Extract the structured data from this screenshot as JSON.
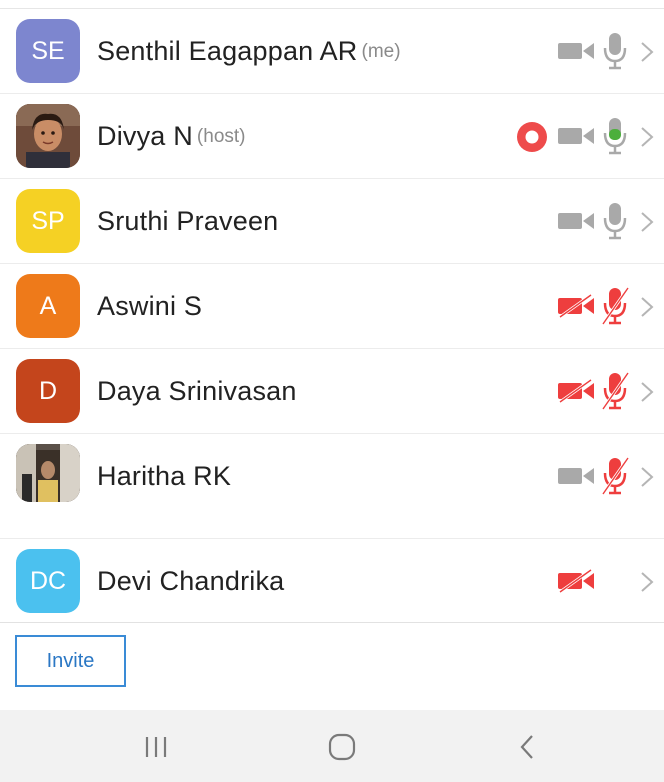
{
  "participants": [
    {
      "initials": "SE",
      "name": "Senthil Eagappan AR",
      "tag": "(me)",
      "avatar_color": "#7d86cf",
      "video": "off",
      "audio": "muted",
      "recording": false
    },
    {
      "initials": "",
      "name": "Divya N",
      "tag": "(host)",
      "avatar_color": "#6b4a3a",
      "video": "off",
      "audio": "speaking",
      "recording": true
    },
    {
      "initials": "SP",
      "name": "Sruthi Praveen",
      "tag": "",
      "avatar_color": "#f5d124",
      "video": "off",
      "audio": "muted",
      "recording": false
    },
    {
      "initials": "A",
      "name": "Aswini S",
      "tag": "",
      "avatar_color": "#ee7a1a",
      "video": "disabled",
      "audio": "disabled",
      "recording": false
    },
    {
      "initials": "D",
      "name": "Daya Srinivasan",
      "tag": "",
      "avatar_color": "#c4451c",
      "video": "disabled",
      "audio": "disabled",
      "recording": false
    },
    {
      "initials": "",
      "name": "Haritha RK",
      "tag": "",
      "avatar_color": "#4a4038",
      "video": "off",
      "audio": "disabled",
      "recording": false
    },
    {
      "initials": "DC",
      "name": "Devi Chandrika",
      "tag": "",
      "avatar_color": "#4bc1ef",
      "video": "disabled",
      "audio": "none",
      "recording": false
    }
  ],
  "footer": {
    "invite_label": "Invite"
  },
  "colors": {
    "icon_gray": "#a9a9a9",
    "icon_red": "#ee3e3e",
    "icon_green": "#4caf3c",
    "accent_blue": "#2a77c4"
  },
  "navbar": {
    "icons": [
      "recent-apps-icon",
      "home-icon",
      "back-icon"
    ]
  }
}
